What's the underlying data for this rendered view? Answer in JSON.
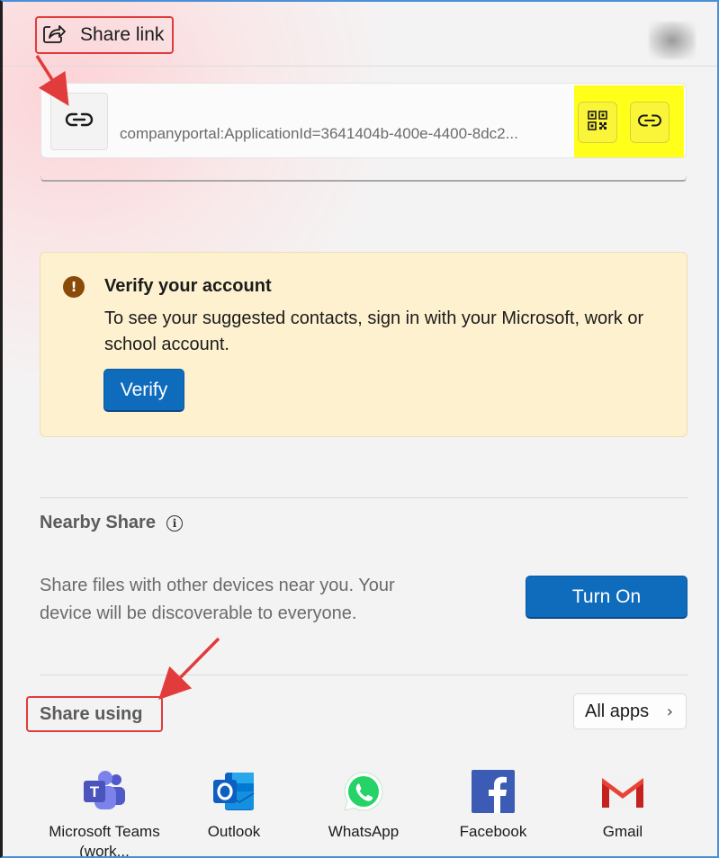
{
  "header": {
    "title": "Share link"
  },
  "link": {
    "url": "companyportal:ApplicationId=3641404b-400e-4400-8dc2..."
  },
  "verify": {
    "title": "Verify your account",
    "text": "To see your suggested contacts, sign in with your Microsoft, work or school account.",
    "button_label": "Verify"
  },
  "nearby": {
    "title": "Nearby Share",
    "info_glyph": "i",
    "description": "Share files with other devices near you. Your device will be discoverable to everyone.",
    "button_label": "Turn On"
  },
  "share_using": {
    "title": "Share using",
    "all_apps_label": "All apps",
    "all_apps_chevron": "›",
    "apps": [
      {
        "label": "Microsoft Teams (work...",
        "icon": "teams-icon"
      },
      {
        "label": "Outlook",
        "icon": "outlook-icon"
      },
      {
        "label": "WhatsApp",
        "icon": "whatsapp-icon"
      },
      {
        "label": "Facebook",
        "icon": "facebook-icon"
      },
      {
        "label": "Gmail",
        "icon": "gmail-icon"
      }
    ]
  },
  "colors": {
    "accent": "#0f6cbd",
    "warning_bg": "#fdf1cf",
    "annotation_red": "#e23b3b",
    "highlight_yellow": "#ffff1a"
  }
}
